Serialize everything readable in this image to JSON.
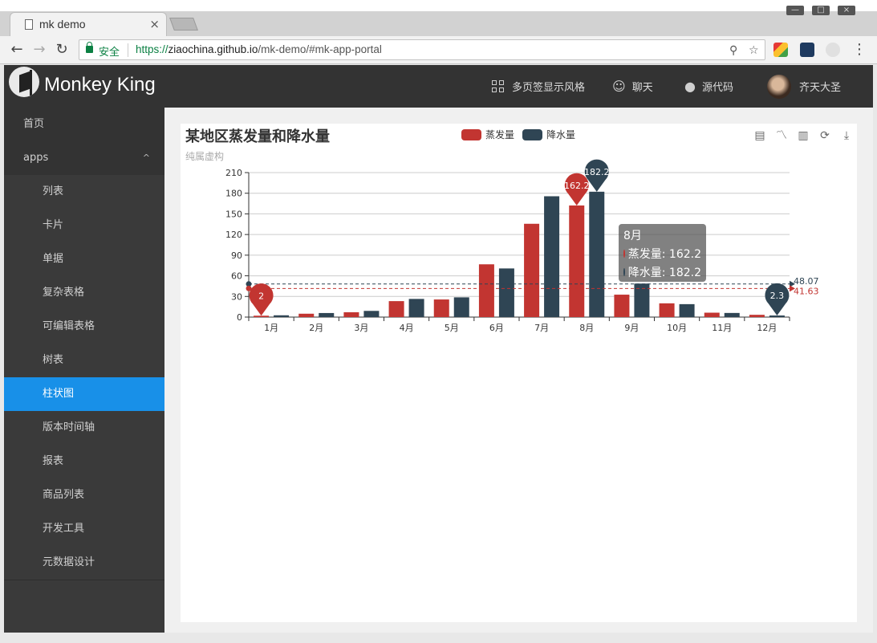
{
  "browser": {
    "tab_title": "mk demo",
    "tab_close": "×",
    "nav": {
      "back": "←",
      "forward": "→",
      "reload": "↻"
    },
    "security_label": "安全",
    "url_scheme": "https://",
    "url_host": "ziaochina.github.io",
    "url_path": "/mk-demo/#mk-app-portal",
    "bookmark_star": "☆",
    "key_icon": "⚲",
    "menu_dots": "⋮",
    "window_buttons": [
      "—",
      "□",
      "×"
    ]
  },
  "header": {
    "brand": "Monkey King",
    "items": [
      {
        "label": "多页签显示风格",
        "icon": "grid-icon"
      },
      {
        "label": "聊天",
        "icon": "smile-icon"
      },
      {
        "label": "源代码",
        "icon": "github-icon"
      },
      {
        "label": "齐天大圣",
        "icon": "avatar"
      }
    ]
  },
  "sidebar": {
    "items": [
      {
        "label": "首页",
        "level": "top"
      },
      {
        "label": "apps",
        "level": "top",
        "caret": "^"
      },
      {
        "label": "列表",
        "level": "sub"
      },
      {
        "label": "卡片",
        "level": "sub"
      },
      {
        "label": "单据",
        "level": "sub"
      },
      {
        "label": "复杂表格",
        "level": "sub"
      },
      {
        "label": "可编辑表格",
        "level": "sub"
      },
      {
        "label": "树表",
        "level": "sub"
      },
      {
        "label": "柱状图",
        "level": "sub",
        "active": true
      },
      {
        "label": "版本时间轴",
        "level": "sub"
      },
      {
        "label": "报表",
        "level": "sub"
      },
      {
        "label": "商品列表",
        "level": "sub"
      },
      {
        "label": "开发工具",
        "level": "sub"
      },
      {
        "label": "元数据设计",
        "level": "sub"
      }
    ]
  },
  "chart_data": {
    "type": "bar",
    "title": "某地区蒸发量和降水量",
    "subtitle": "纯属虚构",
    "categories": [
      "1月",
      "2月",
      "3月",
      "4月",
      "5月",
      "6月",
      "7月",
      "8月",
      "9月",
      "10月",
      "11月",
      "12月"
    ],
    "series": [
      {
        "name": "蒸发量",
        "color": "#c23531",
        "values": [
          2.0,
          4.9,
          7.0,
          23.2,
          25.6,
          76.7,
          135.6,
          162.2,
          32.6,
          20.0,
          6.4,
          3.3
        ]
      },
      {
        "name": "降水量",
        "color": "#2f4554",
        "values": [
          2.6,
          5.9,
          9.0,
          26.4,
          28.7,
          70.7,
          175.6,
          182.2,
          48.7,
          18.8,
          6.0,
          2.3
        ]
      }
    ],
    "ylim": [
      0,
      210
    ],
    "yticks": [
      0,
      30,
      60,
      90,
      120,
      150,
      180,
      210
    ],
    "mark_points": [
      {
        "series": 0,
        "index": 0,
        "label": "2"
      },
      {
        "series": 0,
        "index": 7,
        "label": "162.2"
      },
      {
        "series": 1,
        "index": 7,
        "label": "182.2"
      },
      {
        "series": 1,
        "index": 11,
        "label": "2.3"
      }
    ],
    "mark_lines": [
      {
        "series": 1,
        "value": 48.07,
        "label": "48.07"
      },
      {
        "series": 0,
        "value": 41.63,
        "label": "41.63"
      }
    ],
    "legend_position": "top-center",
    "grid": true
  },
  "toolbox": {
    "items": [
      "data-view-icon",
      "line-chart-icon",
      "bar-chart-icon",
      "restore-icon",
      "download-icon"
    ]
  },
  "tooltip": {
    "title": "8月",
    "rows": [
      {
        "label": "蒸发量: 162.2",
        "color": "#c23531"
      },
      {
        "label": "降水量: 182.2",
        "color": "#2f4554"
      }
    ]
  }
}
